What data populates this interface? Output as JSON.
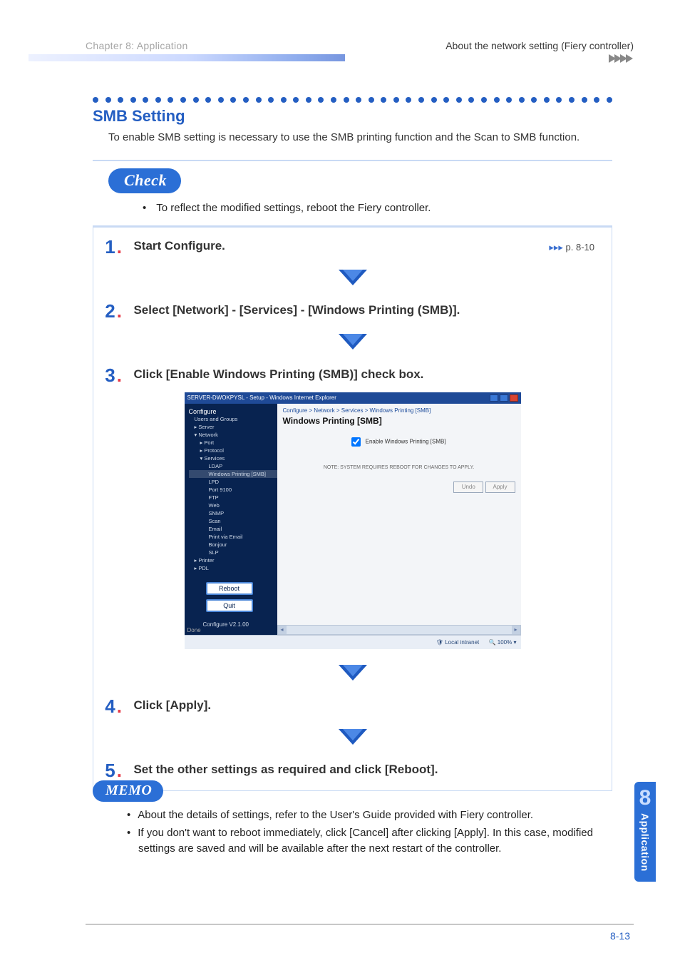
{
  "header": {
    "chapter": "Chapter 8: Application",
    "right": "About the network setting (Fiery controller)"
  },
  "section": {
    "title": "SMB Setting",
    "desc": "To enable SMB setting is necessary to use the SMB printing function and the Scan to SMB function."
  },
  "check": {
    "label": "Check",
    "bullet": "To reflect the modified settings, reboot the Fiery controller."
  },
  "steps": {
    "s1": {
      "num": "1",
      "text": "Start Configure.",
      "link": "p. 8-10"
    },
    "s2": {
      "num": "2",
      "text": "Select [Network] - [Services] - [Windows Printing (SMB)]."
    },
    "s3": {
      "num": "3",
      "text": "Click [Enable Windows Printing (SMB)] check box."
    },
    "s4": {
      "num": "4",
      "text": "Click [Apply]."
    },
    "s5": {
      "num": "5",
      "text": "Set the other settings as required and click [Reboot]."
    }
  },
  "screenshot": {
    "titlebar": "SERVER-DWOKPYSL - Setup - Windows Internet Explorer",
    "configure": "Configure",
    "nav": {
      "users": "Users and Groups",
      "server": "Server",
      "network": "Network",
      "port": "Port",
      "protocol": "Protocol",
      "services": "Services",
      "ldap": "LDAP",
      "winsmb": "Windows Printing [SMB]",
      "lpd": "LPD",
      "port9100": "Port 9100",
      "ftp": "FTP",
      "web": "Web",
      "snmp": "SNMP",
      "scan": "Scan",
      "email": "Email",
      "pve": "Print via Email",
      "bonjour": "Bonjour",
      "slp": "SLP",
      "printer": "Printer",
      "pdl": "PDL"
    },
    "reboot_btn": "Reboot",
    "quit_btn": "Quit",
    "version": "Configure V2.1.00",
    "crumb": "Configure > Network > Services > Windows Printing [SMB]",
    "heading": "Windows Printing [SMB]",
    "checkbox_label": "Enable Windows Printing [SMB]",
    "note": "NOTE: SYSTEM REQUIRES REBOOT FOR CHANGES TO APPLY.",
    "undo": "Undo",
    "apply": "Apply",
    "done": "Done",
    "intranet": "Local intranet",
    "zoom": "100%"
  },
  "memo": {
    "label": "MEMO",
    "b1": "About the details of settings, refer to the User's Guide provided with Fiery controller.",
    "b2": "If you don't want to reboot immediately, click [Cancel] after clicking [Apply]. In this case, modified settings are saved and will be available after the next restart of the controller."
  },
  "sidetab": {
    "num": "8",
    "label": "Application"
  },
  "page_num": "8-13"
}
